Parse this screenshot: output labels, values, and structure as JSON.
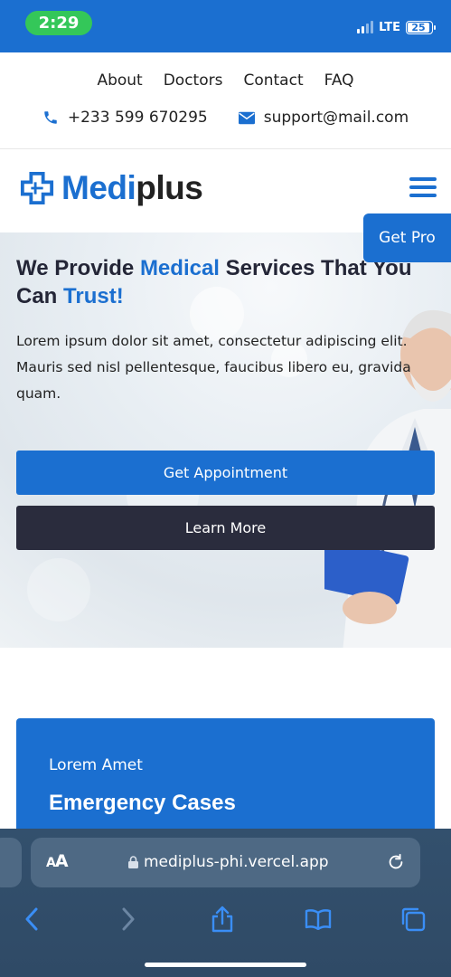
{
  "status_bar": {
    "time": "2:29",
    "network": "LTE",
    "battery": "25"
  },
  "top_nav": {
    "links": [
      "About",
      "Doctors",
      "Contact",
      "FAQ"
    ],
    "phone": "+233 599 670295",
    "email": "support@mail.com"
  },
  "header": {
    "logo_part1": "Medi",
    "logo_part2": "plus",
    "menu_icon": "hamburger-icon"
  },
  "get_pro": "Get Pro",
  "hero": {
    "title_a": "We Provide ",
    "title_hl1": "Medical",
    "title_b": " Services That You Can ",
    "title_hl2": "Trust!",
    "text": "Lorem ipsum dolor sit amet, consectetur adipiscing elit. Mauris sed nisl pellentesque, faucibus libero eu, gravida quam.",
    "primary_button": "Get Appointment",
    "secondary_button": "Learn More"
  },
  "card": {
    "eyebrow": "Lorem Amet",
    "title": "Emergency Cases"
  },
  "browser": {
    "aa_label": "AA",
    "url": "mediplus-phi.vercel.app",
    "toolbar": [
      "back-icon",
      "forward-icon",
      "share-icon",
      "bookmarks-icon",
      "tabs-icon"
    ]
  },
  "colors": {
    "brand": "#1b6fd0",
    "dark": "#2a2c3d",
    "status_green": "#34c759"
  }
}
